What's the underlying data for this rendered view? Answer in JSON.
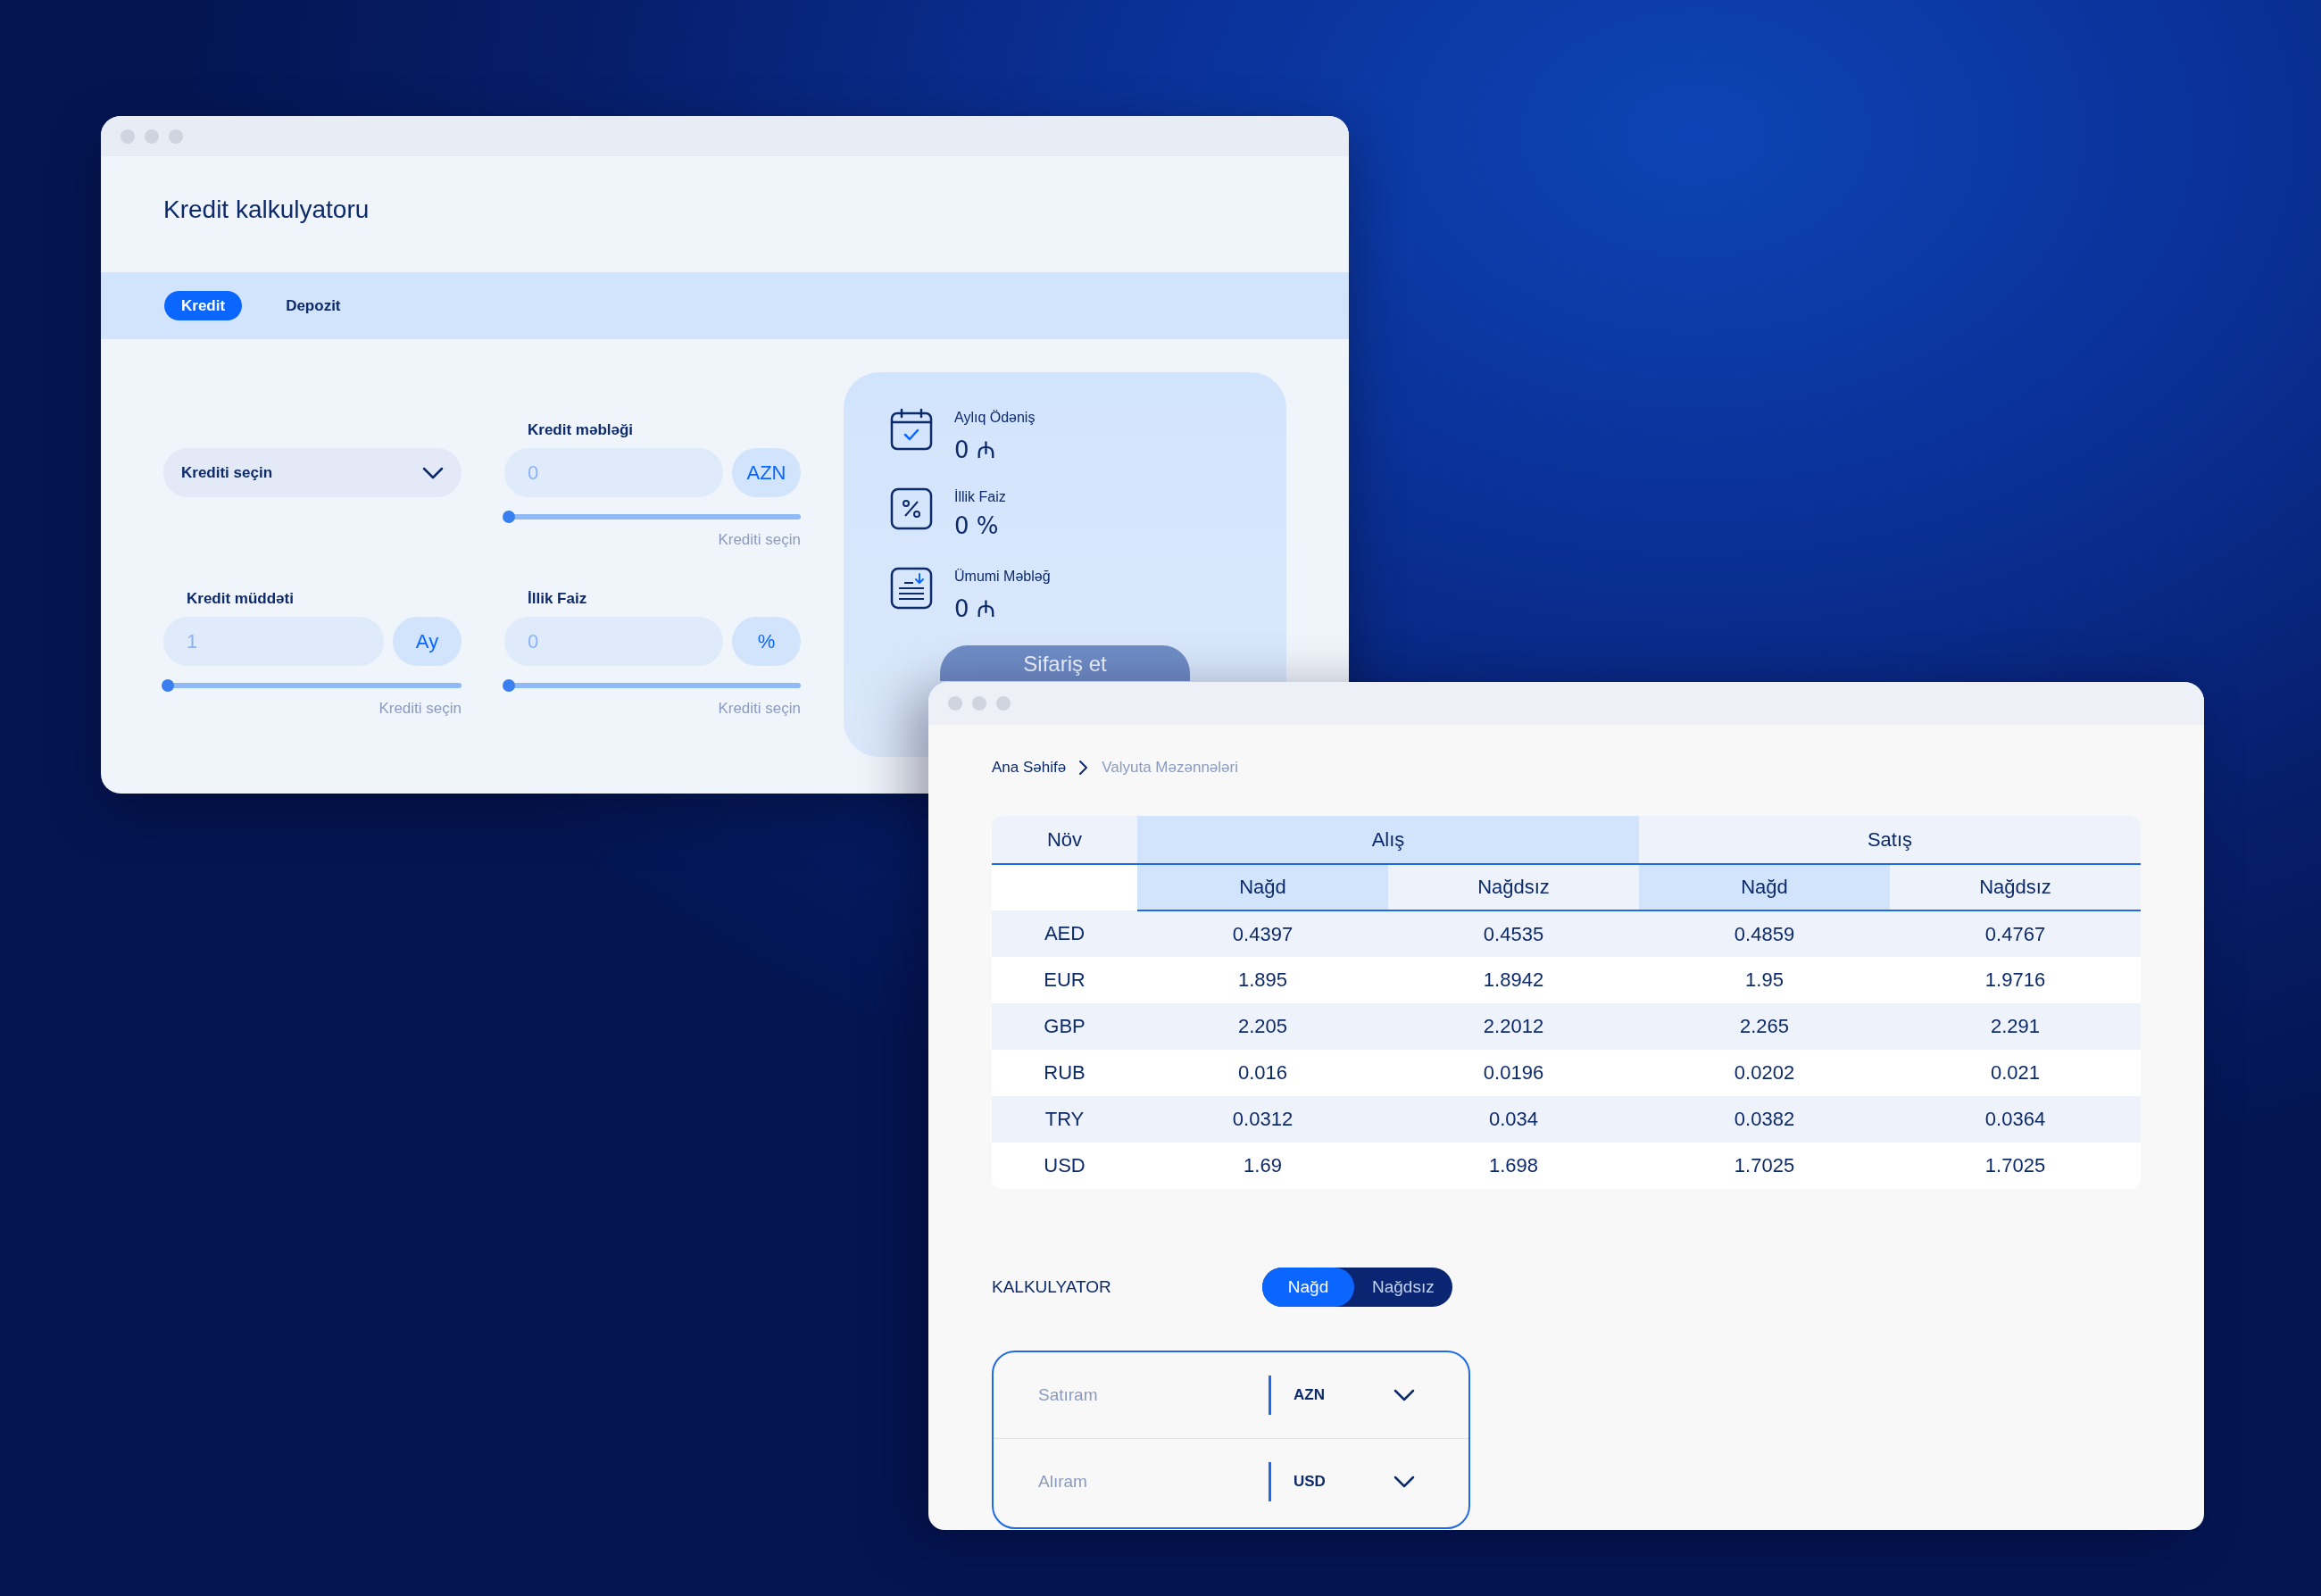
{
  "credit_calculator": {
    "title": "Kredit kalkulyatoru",
    "tabs": [
      {
        "label": "Kredit",
        "selected": true
      },
      {
        "label": "Depozit",
        "selected": false
      }
    ],
    "loan_select": {
      "value": "Krediti seçin"
    },
    "fields": [
      {
        "label": "Kredit məbləği",
        "value": "0",
        "unit": "AZN",
        "level": 0,
        "hint": "Krediti seçin"
      },
      {
        "label": "Kredit müddəti",
        "value": "1",
        "unit": "Ay",
        "level": 0,
        "hint": "Krediti seçin"
      },
      {
        "label": "İllik Faiz",
        "value": "0",
        "unit": "%",
        "level": 0,
        "hint": "Krediti seçin"
      }
    ],
    "summary": [
      {
        "kind": "calendar",
        "label": "Aylıq Ödəniş",
        "value": "0 ₼"
      },
      {
        "kind": "percent",
        "label": "İllik Faiz",
        "value": "0 %"
      },
      {
        "kind": "document",
        "label": "Ümumi Məbləğ",
        "value": "0 ₼"
      }
    ],
    "order_button": "Sifariş et"
  },
  "exchange_rates": {
    "breadcrumb": [
      {
        "label": "Ana Səhifə",
        "current": false
      },
      {
        "label": "Valyuta Məzənnələri",
        "current": true
      }
    ],
    "table": {
      "first_column": "Növ",
      "groups": [
        {
          "label": "Alış",
          "selected": true
        },
        {
          "label": "Satış",
          "selected": false
        }
      ],
      "subcolumns": [
        {
          "label": "Nağd",
          "selected": true
        },
        {
          "label": "Nağdsız",
          "selected": false
        },
        {
          "label": "Nağd",
          "selected": true
        },
        {
          "label": "Nağdsız",
          "selected": false
        }
      ],
      "rows": [
        {
          "currency": "AED",
          "values": [
            "0.4397",
            "0.4535",
            "0.4859",
            "0.4767"
          ]
        },
        {
          "currency": "EUR",
          "values": [
            "1.895",
            "1.8942",
            "1.95",
            "1.9716"
          ]
        },
        {
          "currency": "GBP",
          "values": [
            "2.205",
            "2.2012",
            "2.265",
            "2.291"
          ]
        },
        {
          "currency": "RUB",
          "values": [
            "0.016",
            "0.0196",
            "0.0202",
            "0.021"
          ]
        },
        {
          "currency": "TRY",
          "values": [
            "0.0312",
            "0.034",
            "0.0382",
            "0.0364"
          ]
        },
        {
          "currency": "USD",
          "values": [
            "1.69",
            "1.698",
            "1.7025",
            "1.7025"
          ]
        }
      ]
    },
    "calculator": {
      "title": "KALKULYATOR",
      "modes": [
        {
          "label": "Nağd",
          "selected": true
        },
        {
          "label": "Nağdsız",
          "selected": false
        }
      ],
      "rows": [
        {
          "placeholder": "Satıram",
          "currency": "AZN"
        },
        {
          "placeholder": "Alıram",
          "currency": "USD"
        }
      ]
    }
  }
}
